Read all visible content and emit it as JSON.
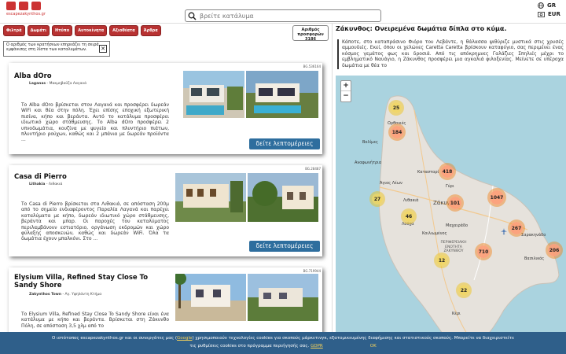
{
  "header": {
    "logo_text": "escapezakynthos.gr",
    "search_placeholder": "βρείτε κατάλυμα",
    "lang": "GR",
    "currency": "EUR"
  },
  "filters": [
    "Φιλτρά",
    "Δωμάτι",
    "Ητύπο",
    "Αυτοκίνητα",
    "Αξιοθέατα",
    "Άρθρα"
  ],
  "offers": {
    "label": "Αριθμός προσφορών",
    "count": "3186"
  },
  "notice": {
    "text": "Ο αριθμός των κρατήσεων επηρεάζει τη σειρά εμφάνισης στη λίστα των καταλυμάτων.",
    "close": "✕"
  },
  "cards": [
    {
      "id": "BG.536164",
      "title": "Alba dOro",
      "loc_bold": "Laganas",
      "loc_rest": "- Μακμηβούζα Λαγανά",
      "desc": "Το Alba dOro βρίσκεται στον Λαγανά και προσφέρει δωρεάν WiFi και θέα στην πόλη. Έχει επίσης εποχική εξωτερική πισίνα, κήπο και βεράντα. Αυτό το κατάλυμα προσφέρει ιδιωτικό χώρο στάθμευσης. Το Alba dOro προσφέρει 2 υπνοδωμάτια, κουζίνα με ψυγείο και πλυντήριο πιάτων, πλυντήριο ρούχων, καθώς και 2 μπάνια με δωρεάν προϊόντα ...",
      "button": "δείτε λεπτομέρειες"
    },
    {
      "id": "BG.28487",
      "title": "Casa di Pierro",
      "loc_bold": "Lithakia",
      "loc_rest": "- Λιθακιά",
      "desc": "Το Casa di Pierro βρίσκεται στα Λιθακιά, σε απόσταση 200μ από το σημείο ενδιαφέροντος Παραλία Λαγανά και παρέχει καταλύματα με κήπο, δωρεάν ιδιωτικό χώρο στάθμευσης, βεράντα και μπαρ. Οι παροχές του καταλύματος περιλαμβάνουν εστιατόριο, οργάνωση εκδρομών και χώρο φύλαξης αποσκευών, καθώς και δωρεάν WiFi. Όλα τα δωμάτια έχουν μπαλκόνι. Στο ...",
      "button": "δείτε λεπτομέρειες"
    },
    {
      "id": "BG.719944",
      "title": "Elysium Villa, Refined Stay Close To Sandy Shore",
      "loc_bold": "Zakynthos Town",
      "loc_rest": "- Αγ. Υψηλάντη Κτήμα",
      "desc": "Το Elysium Villa, Refined Stay Close To Sandy Shore είναι ένα κατάλυμα με κήπο και βεράντα. Βρίσκεται στη Ζάκυνθο Πόλη, σε απόσταση 3,5 χλμ από το",
      "button": ""
    }
  ],
  "map": {
    "title": "Ζάκυνθος: Ονειρεμένα δωμάτια δίπλα στο κύμα.",
    "text": "Κάποτε, στο καταπράσινο Φιόρο του Λεβάντε, η θάλασσα ψιθύριζε μυστικά στις χρυσές αμμουδιές. Εκεί, όπου οι χελώνες Caretta Caretta βρίσκουν καταφύγιο, σας περιμένει ένας κόσμος γεμάτος φως και δροσιά. Από τις απόκρημνες Γαλάζιες Σπηλιές μέχρι το εμβληματικό Ναυάγιο, η Ζάκυνθος προσφέρει μια αγκαλιά φιλοξενίας. Μείνετε σε υπέροχα δωμάτια με θέα το",
    "zoom_in": "+",
    "zoom_out": "−",
    "clusters": [
      "25",
      "184",
      "418",
      "27",
      "101",
      "1047",
      "46",
      "267",
      "710",
      "206",
      "12",
      "22"
    ],
    "places": [
      "Βολίμες",
      "Αναφωνήτρια",
      "Κατασταρί",
      "Άγιος Λέων",
      "Λιθακιά",
      "Ζάκυνθος",
      "Κοιλιωμένος",
      "Μαχαιράδο",
      "Σαρακηνάδο",
      "ΠΕΡΙΦΕΡΕΙΑΚΗ ΕΝΟΤΗΤΑ ΖΑΚΥΝΘΟΥ",
      "Βασιλικός",
      "Λούχα",
      "Γύρι",
      "Ορθονιές",
      "Κέρι"
    ]
  },
  "cookie": {
    "text1": "Ο ιστότοπος escapezakynthos.gr και οι συνεργάτες μας (",
    "link1": "Google",
    "text2": ") χρησιμοποιούν τεχνολογίες cookies για σκοπούς μάρκετινγκ, εξατομικευμένης διαφήμισης και στατιστικούς σκοπούς. Μπορείτε να διαχειριστείτε",
    "text3": "τις ρυθμίσεις cookies στο πρόγραμμα περιήγησής σας.",
    "link2": "GDPR",
    "ok": "OK"
  }
}
